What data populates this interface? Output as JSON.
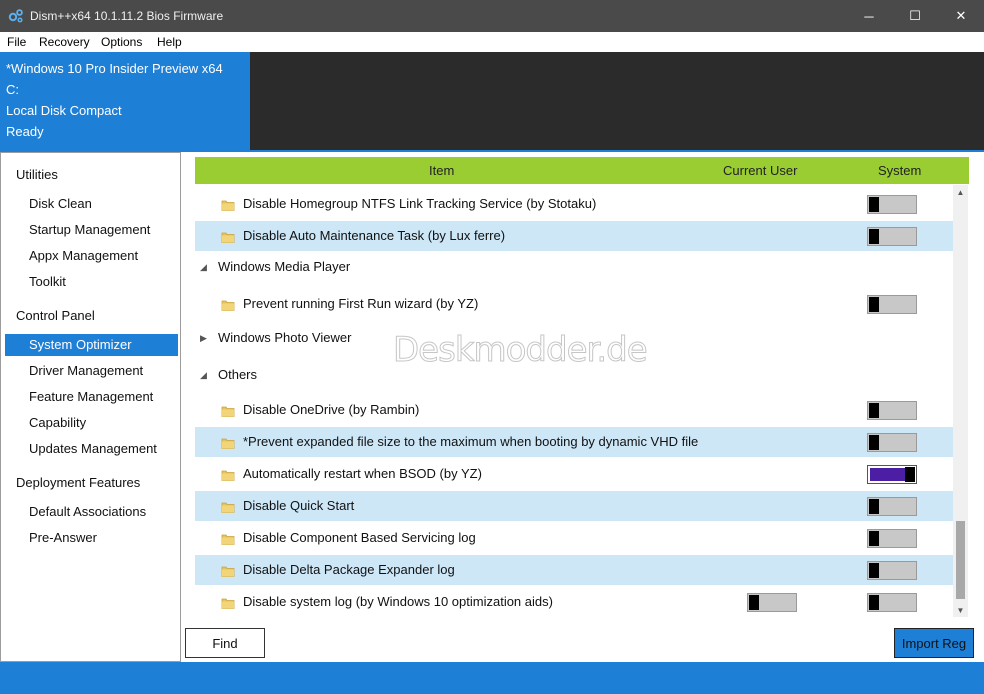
{
  "window": {
    "title": "Dism++x64 10.1.11.2 Bios Firmware",
    "controls": {
      "minimize": "─",
      "maximize": "☐",
      "close": "✕"
    }
  },
  "menu": [
    "File",
    "Recovery",
    "Options",
    "Help"
  ],
  "info": {
    "os": "*Windows 10 Pro Insider Preview x64",
    "drive": "C:",
    "disk": "Local Disk Compact",
    "status": "Ready"
  },
  "sidebar": {
    "categories": [
      {
        "label": "Utilities",
        "items": [
          "Disk Clean",
          "Startup Management",
          "Appx Management",
          "Toolkit"
        ]
      },
      {
        "label": "Control Panel",
        "items": [
          "System Optimizer",
          "Driver Management",
          "Feature Management",
          "Capability",
          "Updates Management"
        ]
      },
      {
        "label": "Deployment Features",
        "items": [
          "Default Associations",
          "Pre-Answer"
        ]
      }
    ],
    "selected": "System Optimizer"
  },
  "list": {
    "columns": {
      "item": "Item",
      "current_user": "Current User",
      "system": "System"
    },
    "rows": [
      {
        "type": "item",
        "text": "Disable Homegroup NTFS Link Tracking Service (by Stotaku)",
        "system": false,
        "shaded": false
      },
      {
        "type": "item",
        "text": "Disable Auto Maintenance Task (by Lux ferre)",
        "system": false,
        "shaded": true
      },
      {
        "type": "group",
        "text": "Windows Media Player",
        "expanded": true,
        "arrow": "◢"
      },
      {
        "type": "item",
        "text": "Prevent running First Run wizard (by YZ)",
        "system": false,
        "shaded": false
      },
      {
        "type": "group",
        "text": "Windows Photo Viewer",
        "expanded": false,
        "arrow": "▶"
      },
      {
        "type": "group",
        "text": "Others",
        "expanded": true,
        "arrow": "◢"
      },
      {
        "type": "item",
        "text": "Disable OneDrive (by Rambin)",
        "system": false,
        "shaded": false
      },
      {
        "type": "item",
        "text": "*Prevent expanded file size to the maximum when booting by dynamic VHD file",
        "system": false,
        "shaded": true
      },
      {
        "type": "item",
        "text": "Automatically restart when BSOD (by YZ)",
        "system": true,
        "shaded": false
      },
      {
        "type": "item",
        "text": "Disable Quick Start",
        "system": false,
        "shaded": true
      },
      {
        "type": "item",
        "text": "Disable Component Based Servicing log",
        "system": false,
        "shaded": false
      },
      {
        "type": "item",
        "text": "Disable Delta Package Expander log",
        "system": false,
        "shaded": true
      },
      {
        "type": "item",
        "text": "Disable system log (by Windows 10 optimization aids)",
        "system": false,
        "current_user": false,
        "shaded": false
      }
    ]
  },
  "watermark": "Deskmodder.de",
  "buttons": {
    "find": "Find",
    "import": "Import Reg"
  },
  "colors": {
    "accent": "#1e7fd6",
    "header": "#9acd32",
    "row_shade": "#cde7f7",
    "toggle_on": "#4b1ea3"
  }
}
